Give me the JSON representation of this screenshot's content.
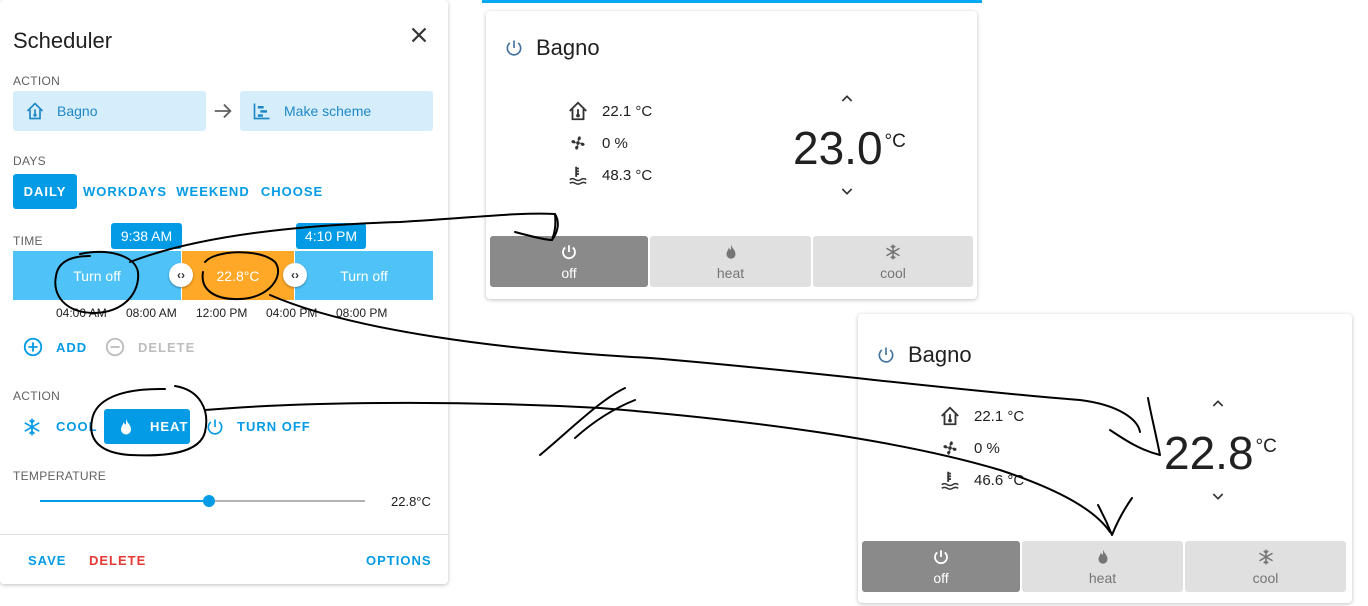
{
  "scheduler": {
    "title": "Scheduler",
    "action_label": "ACTION",
    "entity_chip": "Bagno",
    "service_chip": "Make scheme",
    "days_label": "DAYS",
    "days_tabs": [
      "DAILY",
      "WORKDAYS",
      "WEEKEND",
      "CHOOSE"
    ],
    "days_active": "DAILY",
    "time_label": "TIME",
    "time_tip_1": "9:38 AM",
    "time_tip_2": "4:10 PM",
    "segments": [
      "Turn off",
      "22.8°C",
      "Turn off"
    ],
    "ticks": [
      "04:00 AM",
      "08:00 AM",
      "12:00 PM",
      "04:00 PM",
      "08:00 PM"
    ],
    "add_label": "ADD",
    "delete_slot_label": "DELETE",
    "action2_label": "ACTION",
    "modes": [
      "COOL",
      "HEAT",
      "TURN OFF"
    ],
    "mode_active": "HEAT",
    "temperature_label": "TEMPERATURE",
    "temperature_value": "22.8°C",
    "temperature_fraction": 0.52,
    "save_label": "SAVE",
    "delete_label": "DELETE",
    "options_label": "OPTIONS"
  },
  "thermostat_1": {
    "name": "Bagno",
    "indoor_temp": "22.1 °C",
    "fan": "0 %",
    "water_temp": "48.3 °C",
    "target": "23.0",
    "unit": "°C",
    "buttons": [
      "off",
      "heat",
      "cool"
    ],
    "active": "off"
  },
  "thermostat_2": {
    "name": "Bagno",
    "indoor_temp": "22.1 °C",
    "fan": "0 %",
    "water_temp": "46.6 °C",
    "target": "22.8",
    "unit": "°C",
    "buttons": [
      "off",
      "heat",
      "cool"
    ],
    "active": "off"
  },
  "colors": {
    "accent": "#039be5",
    "chip_bg": "#d6eefb",
    "segment_blue": "#4fc3f7",
    "segment_orange": "#ffa726",
    "delete_red": "#e53935",
    "button_active": "#8a8a8a",
    "button_idle": "#e0e0e0"
  },
  "icons": [
    "close-icon",
    "home-thermometer-icon",
    "arrow-right-icon",
    "chart-gantt-icon",
    "plus-circle-icon",
    "minus-circle-icon",
    "snowflake-icon",
    "fire-icon",
    "power-icon",
    "fan-icon",
    "water-boiler-icon",
    "chevron-up-icon",
    "chevron-down-icon"
  ]
}
